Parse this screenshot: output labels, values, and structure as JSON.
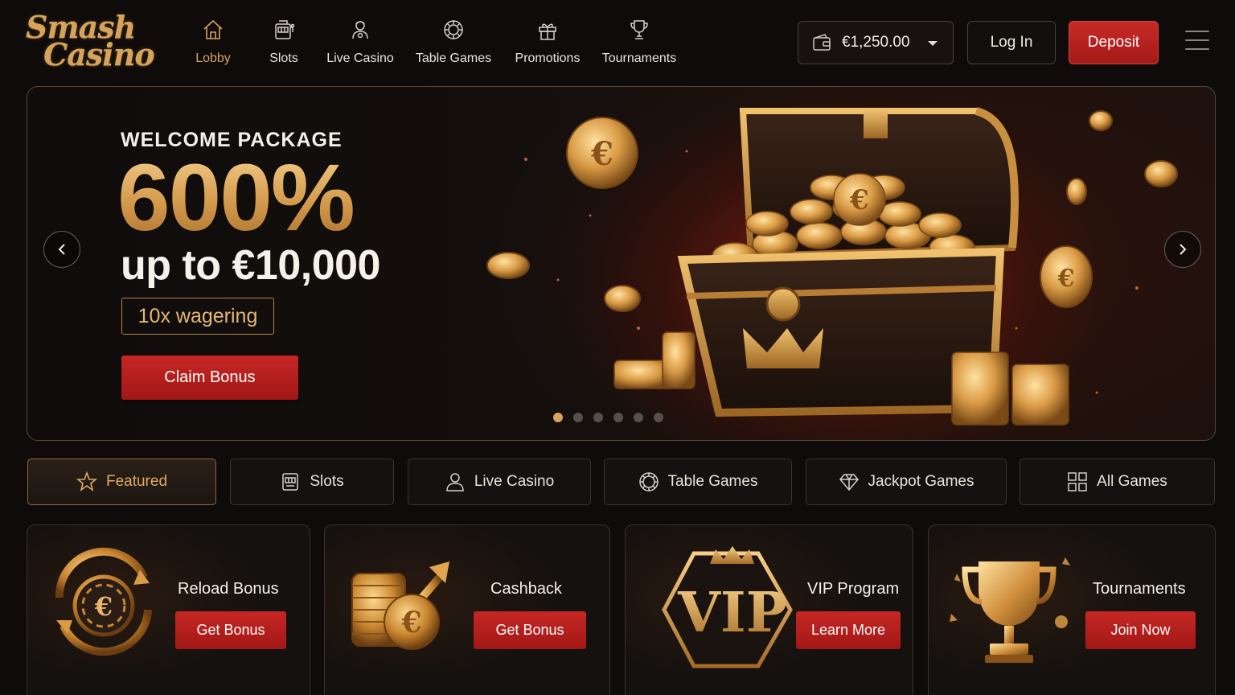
{
  "brand": {
    "line1": "Smash",
    "line2": "Casino"
  },
  "nav": [
    {
      "label": "Lobby",
      "icon": "home-icon",
      "active": true
    },
    {
      "label": "Slots",
      "icon": "slot-machine-icon"
    },
    {
      "label": "Live Casino",
      "icon": "dealer-icon"
    },
    {
      "label": "Table Games",
      "icon": "roulette-chip-icon"
    },
    {
      "label": "Promotions",
      "icon": "gift-icon"
    },
    {
      "label": "Tournaments",
      "icon": "trophy-icon"
    }
  ],
  "header": {
    "balance": "€1,250.00",
    "login_label": "Log In",
    "deposit_label": "Deposit"
  },
  "hero": {
    "kicker": "WELCOME PACKAGE",
    "headline": "600%",
    "subline": "up to €10,000",
    "tag": "10x wagering",
    "cta": "Claim Bonus",
    "slide_count": 6,
    "active_slide": 1
  },
  "tabs": [
    {
      "label": "Featured",
      "icon": "star-icon",
      "active": true
    },
    {
      "label": "Slots",
      "icon": "slot-machine-icon"
    },
    {
      "label": "Live Casino",
      "icon": "user-icon"
    },
    {
      "label": "Table Games",
      "icon": "roulette-chip-icon"
    },
    {
      "label": "Jackpot Games",
      "icon": "diamond-icon"
    },
    {
      "label": "All Games",
      "icon": "grid-icon"
    }
  ],
  "promos": [
    {
      "title": "Reload Bonus",
      "button": "Get Bonus",
      "icon": "reload-chip-icon"
    },
    {
      "title": "Cashback",
      "button": "Get Bonus",
      "icon": "coin-stack-arrow-icon"
    },
    {
      "title": "VIP Program",
      "button": "Learn More",
      "icon": "vip-crown-badge-icon",
      "badge_text": "VIP"
    },
    {
      "title": "Tournaments",
      "button": "Join Now",
      "icon": "gold-trophy-icon"
    }
  ],
  "colors": {
    "accent_gold": "#d9a25e",
    "cta_red": "#b51f1c",
    "background": "#0e0b0a"
  }
}
